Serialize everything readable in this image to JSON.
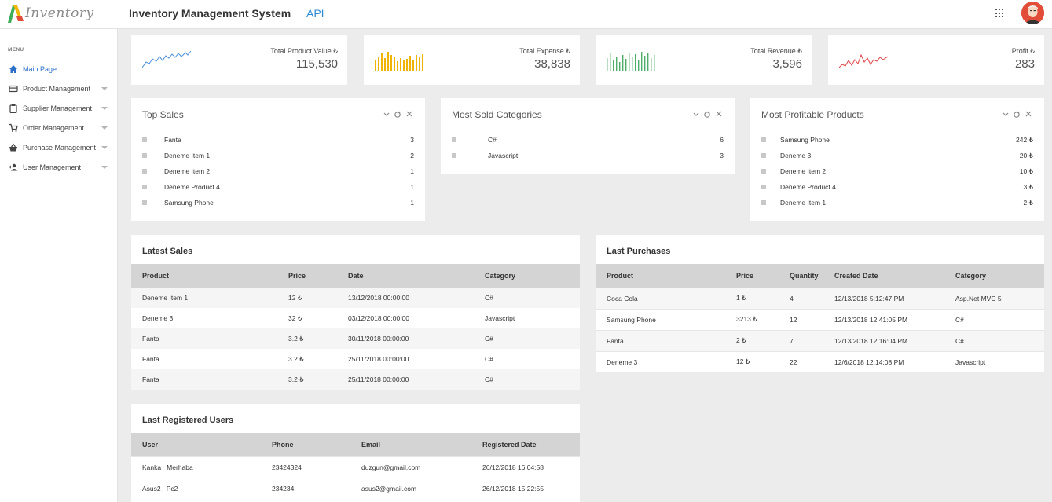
{
  "header": {
    "logo_text": "Inventory",
    "title": "Inventory Management System",
    "api_label": "API",
    "apps_icon": "apps-grid-icon",
    "avatar_icon": "user-avatar"
  },
  "sidebar": {
    "menu_label": "MENU",
    "items": [
      {
        "label": "Main Page",
        "icon": "home-icon",
        "active": true
      },
      {
        "label": "Product Management",
        "icon": "card-icon"
      },
      {
        "label": "Supplier Management",
        "icon": "clipboard-icon"
      },
      {
        "label": "Order Management",
        "icon": "cart-icon"
      },
      {
        "label": "Purchase Management",
        "icon": "basket-icon"
      },
      {
        "label": "User Management",
        "icon": "add-user-icon"
      }
    ]
  },
  "stats": [
    {
      "label": "Total Product Value ₺",
      "value": "115,530",
      "spark_type": "line",
      "color": "#4a8fd6"
    },
    {
      "label": "Total Expense ₺",
      "value": "38,838",
      "spark_type": "bar",
      "color": "#f0b400"
    },
    {
      "label": "Total Revenue ₺",
      "value": "3,596",
      "spark_type": "bar",
      "color": "#4cae6a"
    },
    {
      "label": "Profit ₺",
      "value": "283",
      "spark_type": "line",
      "color": "#e0464a"
    }
  ],
  "widgets": {
    "top_sales": {
      "title": "Top Sales",
      "items": [
        {
          "name": "Fanta",
          "value": "3"
        },
        {
          "name": "Deneme Item 1",
          "value": "2"
        },
        {
          "name": "Deneme Item 2",
          "value": "1"
        },
        {
          "name": "Deneme Product 4",
          "value": "1"
        },
        {
          "name": "Samsung Phone",
          "value": "1"
        }
      ]
    },
    "most_sold_categories": {
      "title": "Most Sold Categories",
      "items": [
        {
          "name": "C#",
          "value": "6"
        },
        {
          "name": "Javascript",
          "value": "3"
        }
      ]
    },
    "most_profitable_products": {
      "title": "Most Profitable Products",
      "items": [
        {
          "name": "Samsung Phone",
          "value": "242 ₺"
        },
        {
          "name": "Deneme 3",
          "value": "20 ₺"
        },
        {
          "name": "Deneme Item 2",
          "value": "10 ₺"
        },
        {
          "name": "Deneme Product 4",
          "value": "3 ₺"
        },
        {
          "name": "Deneme Item 1",
          "value": "2 ₺"
        }
      ]
    }
  },
  "latest_sales": {
    "title": "Latest Sales",
    "columns": [
      "Product",
      "Price",
      "Date",
      "Category"
    ],
    "rows": [
      [
        "Deneme Item 1",
        "12 ₺",
        "13/12/2018 00:00:00",
        "C#"
      ],
      [
        "Deneme 3",
        "32 ₺",
        "03/12/2018 00:00:00",
        "Javascript"
      ],
      [
        "Fanta",
        "3.2 ₺",
        "30/11/2018 00:00:00",
        "C#"
      ],
      [
        "Fanta",
        "3.2 ₺",
        "25/11/2018 00:00:00",
        "C#"
      ],
      [
        "Fanta",
        "3.2 ₺",
        "25/11/2018 00:00:00",
        "C#"
      ]
    ]
  },
  "last_purchases": {
    "title": "Last Purchases",
    "columns": [
      "Product",
      "Price",
      "Quantity",
      "Created Date",
      "Category"
    ],
    "rows": [
      [
        "Coca Cola",
        "1 ₺",
        "4",
        "12/13/2018 5:12:47 PM",
        "Asp.Net MVC 5"
      ],
      [
        "Samsung Phone",
        "3213 ₺",
        "12",
        "12/13/2018 12:41:05 PM",
        "C#"
      ],
      [
        "Fanta",
        "2 ₺",
        "7",
        "12/13/2018 12:16:04 PM",
        "C#"
      ],
      [
        "Deneme 3",
        "12 ₺",
        "22",
        "12/6/2018 12:14:08 PM",
        "Javascript"
      ]
    ]
  },
  "last_users": {
    "title": "Last Registered Users",
    "columns": [
      "User",
      "Phone",
      "Email",
      "Registered Date"
    ],
    "rows": [
      [
        "Kanka   Merhaba",
        "23424324",
        "duzgun@gmail.com",
        "26/12/2018 16:04:58"
      ],
      [
        "Asus2   Pc2",
        "234234",
        "asus2@gmail.com",
        "26/12/2018 15:22:55"
      ]
    ]
  }
}
